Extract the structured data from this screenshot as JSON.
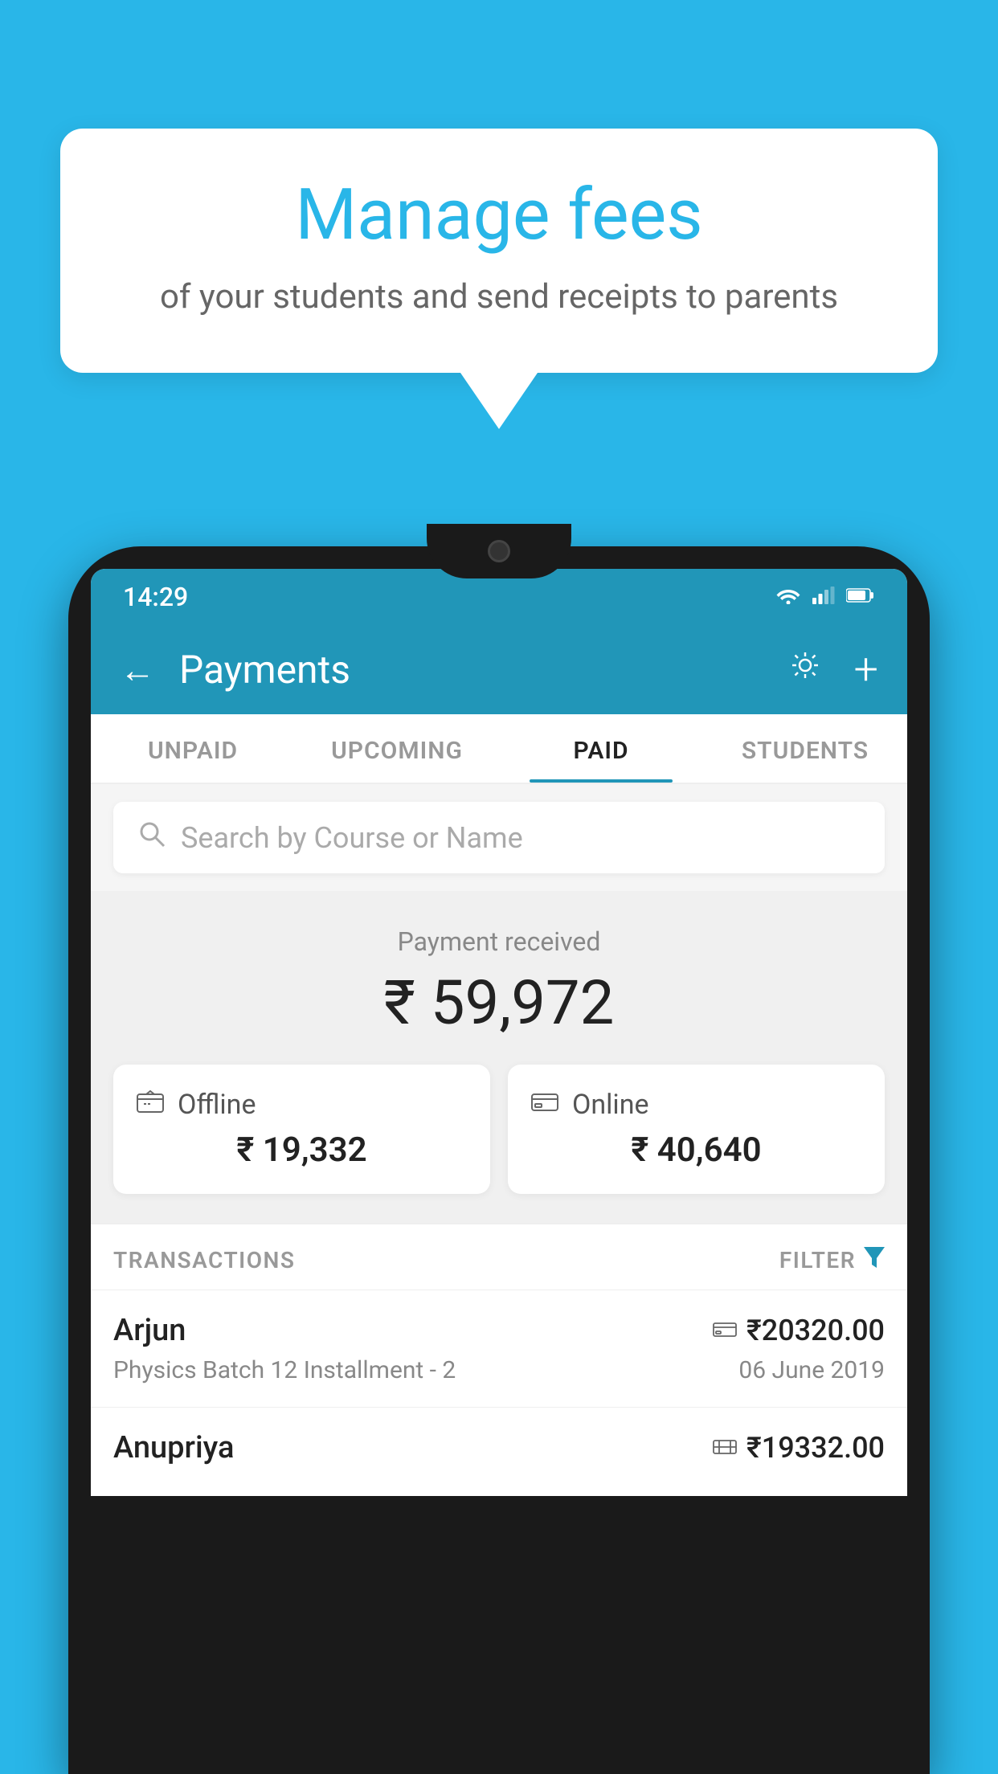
{
  "page": {
    "background_color": "#29b6e8"
  },
  "speech_bubble": {
    "title": "Manage fees",
    "subtitle": "of your students and send receipts to parents"
  },
  "status_bar": {
    "time": "14:29"
  },
  "header": {
    "title": "Payments",
    "back_label": "←",
    "plus_label": "+"
  },
  "tabs": [
    {
      "label": "UNPAID",
      "active": false
    },
    {
      "label": "UPCOMING",
      "active": false
    },
    {
      "label": "PAID",
      "active": true
    },
    {
      "label": "STUDENTS",
      "active": false
    }
  ],
  "search": {
    "placeholder": "Search by Course or Name"
  },
  "payment_received": {
    "label": "Payment received",
    "total": "₹ 59,972",
    "offline": {
      "type": "Offline",
      "amount": "₹ 19,332"
    },
    "online": {
      "type": "Online",
      "amount": "₹ 40,640"
    }
  },
  "transactions_section": {
    "label": "TRANSACTIONS",
    "filter_label": "FILTER"
  },
  "transactions": [
    {
      "name": "Arjun",
      "course": "Physics Batch 12 Installment - 2",
      "amount": "₹20320.00",
      "date": "06 June 2019",
      "icon": "card"
    },
    {
      "name": "Anupriya",
      "course": "",
      "amount": "₹19332.00",
      "date": "",
      "icon": "cash"
    }
  ]
}
